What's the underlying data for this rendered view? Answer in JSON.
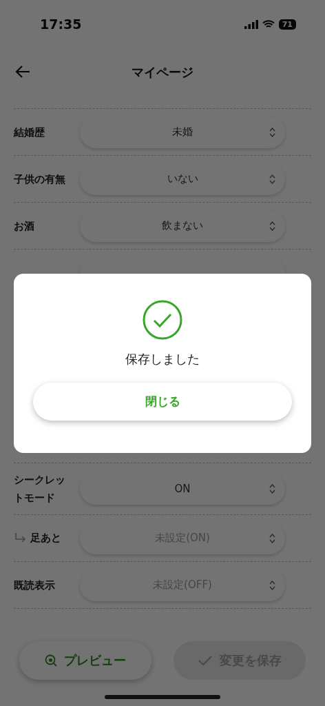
{
  "status_bar": {
    "time": "17:35",
    "battery": "71"
  },
  "header": {
    "title": "マイページ"
  },
  "rows_top": [
    {
      "label": "結婚歴",
      "value": "未婚",
      "disabled": false,
      "kind": "plain"
    },
    {
      "label": "子供の有無",
      "value": "いない",
      "disabled": false,
      "kind": "plain"
    },
    {
      "label": "お酒",
      "value": "飲まない",
      "disabled": false,
      "kind": "plain"
    },
    {
      "kind": "covered"
    }
  ],
  "rows_bottom": [
    {
      "label": "シークレットモード",
      "value": "ON",
      "disabled": false,
      "kind": "plain"
    },
    {
      "label": "足あと",
      "value": "未設定(ON)",
      "disabled": true,
      "kind": "sub"
    },
    {
      "label": "既読表示",
      "value": "未設定(OFF)",
      "disabled": true,
      "kind": "plain"
    }
  ],
  "footer": {
    "preview": {
      "label": "プレビュー"
    },
    "save": {
      "label": "変更を保存",
      "disabled": true
    }
  },
  "modal": {
    "message": "保存しました",
    "close": "閉じる"
  }
}
